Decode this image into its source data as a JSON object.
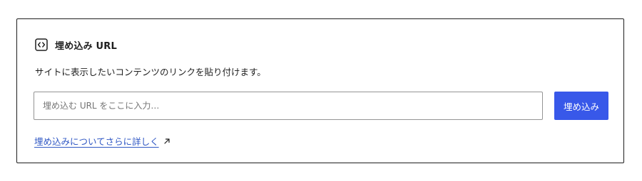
{
  "embed_block": {
    "icon": "embed-code-icon",
    "title": "埋め込み URL",
    "description": "サイトに表示したいコンテンツのリンクを貼り付けます。",
    "input": {
      "value": "",
      "placeholder": "埋め込む URL をここに入力…"
    },
    "button_label": "埋め込み",
    "learn_more_label": "埋め込みについてさらに詳しく",
    "learn_more_icon": "external-link-icon"
  },
  "colors": {
    "accent": "#3858e9",
    "link": "#2f57c4",
    "border": "#1e1e1e",
    "input_border": "#949494"
  }
}
